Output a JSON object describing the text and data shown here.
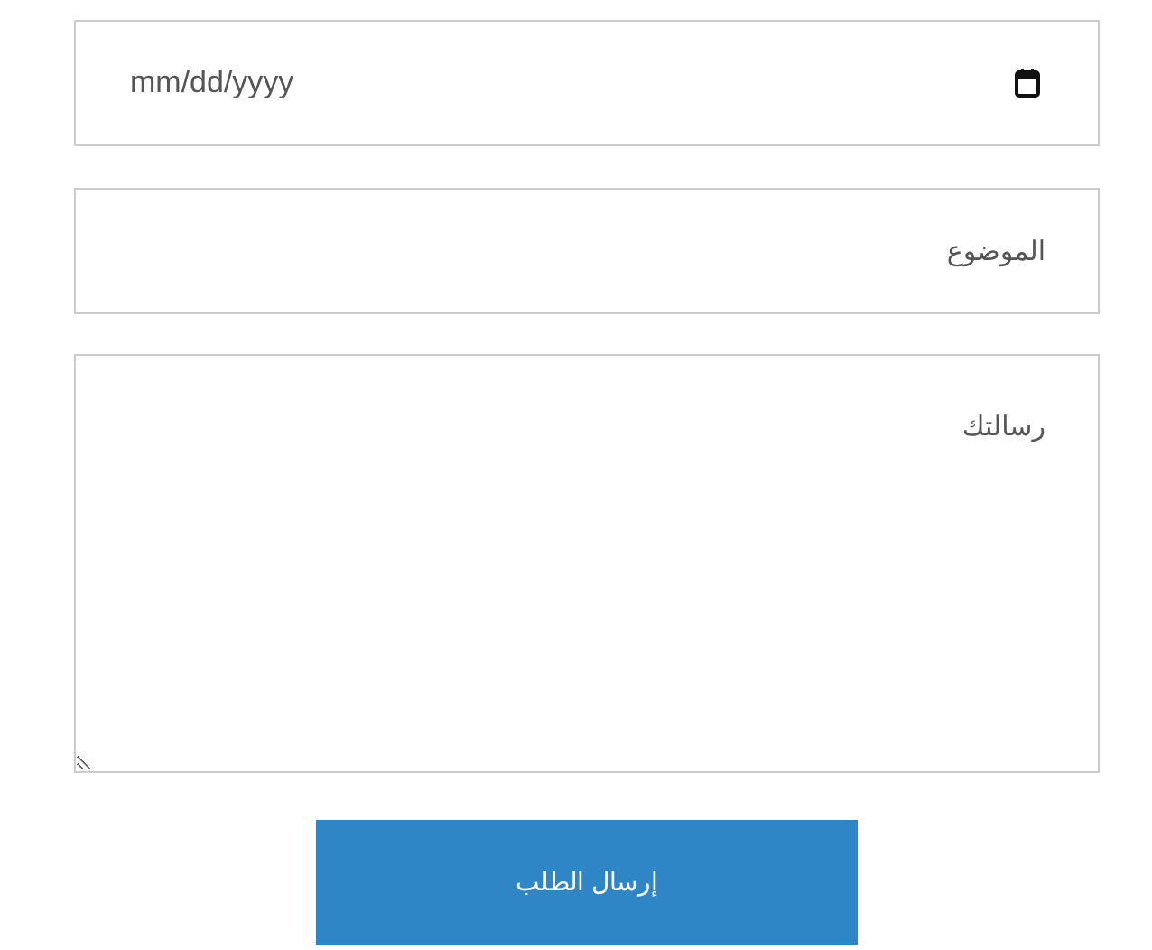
{
  "date_field": {
    "placeholder": "mm/dd/yyyy"
  },
  "subject_field": {
    "placeholder": "الموضوع"
  },
  "message_field": {
    "placeholder": "رسالتك"
  },
  "submit_button": {
    "label": "إرسال الطلب"
  }
}
